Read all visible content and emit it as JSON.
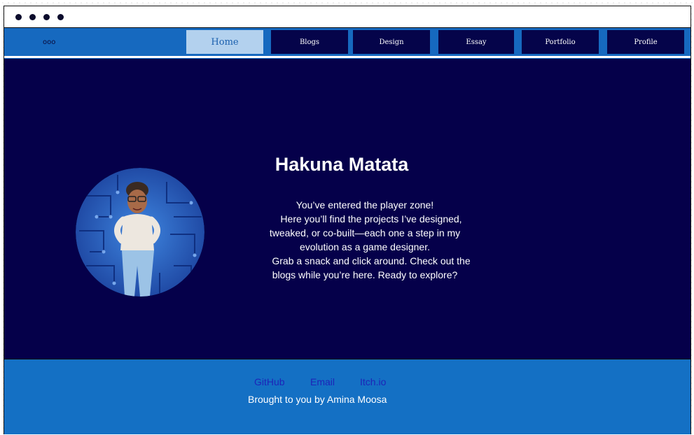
{
  "window": {
    "dots": [
      "dot",
      "dot",
      "dot",
      "dot"
    ]
  },
  "nav": {
    "menu_icon": "ooo",
    "tabs": [
      {
        "label": "Home",
        "active": true
      },
      {
        "label": "Blogs",
        "active": false
      },
      {
        "label": "Design",
        "active": false
      },
      {
        "label": "Essay",
        "active": false
      },
      {
        "label": "Portfolio",
        "active": false
      },
      {
        "label": "Profile",
        "active": false
      }
    ]
  },
  "hero": {
    "title": "Hakuna Matata",
    "intro_lines": [
      "You’ve entered the player zone!",
      "Here you’ll find the projects I’ve designed,",
      "tweaked, or co-built—each one a step in my",
      "evolution as a game designer.",
      "Grab a snack and click around. Check out the",
      "blogs while you’re here. Ready to explore?"
    ],
    "avatar_icon": "avatar-circuit-portrait"
  },
  "footer": {
    "links": [
      "GitHub",
      "Email",
      "Itch.io"
    ],
    "credit": "Brought to you by Amina Moosa"
  },
  "colors": {
    "nav_bg": "#1669bf",
    "tab_bg": "#05044a",
    "active_tab_bg": "#b3d1ee",
    "hero_bg": "#05004a",
    "footer_bg": "#1470c4",
    "footer_link": "#1d24b8"
  }
}
